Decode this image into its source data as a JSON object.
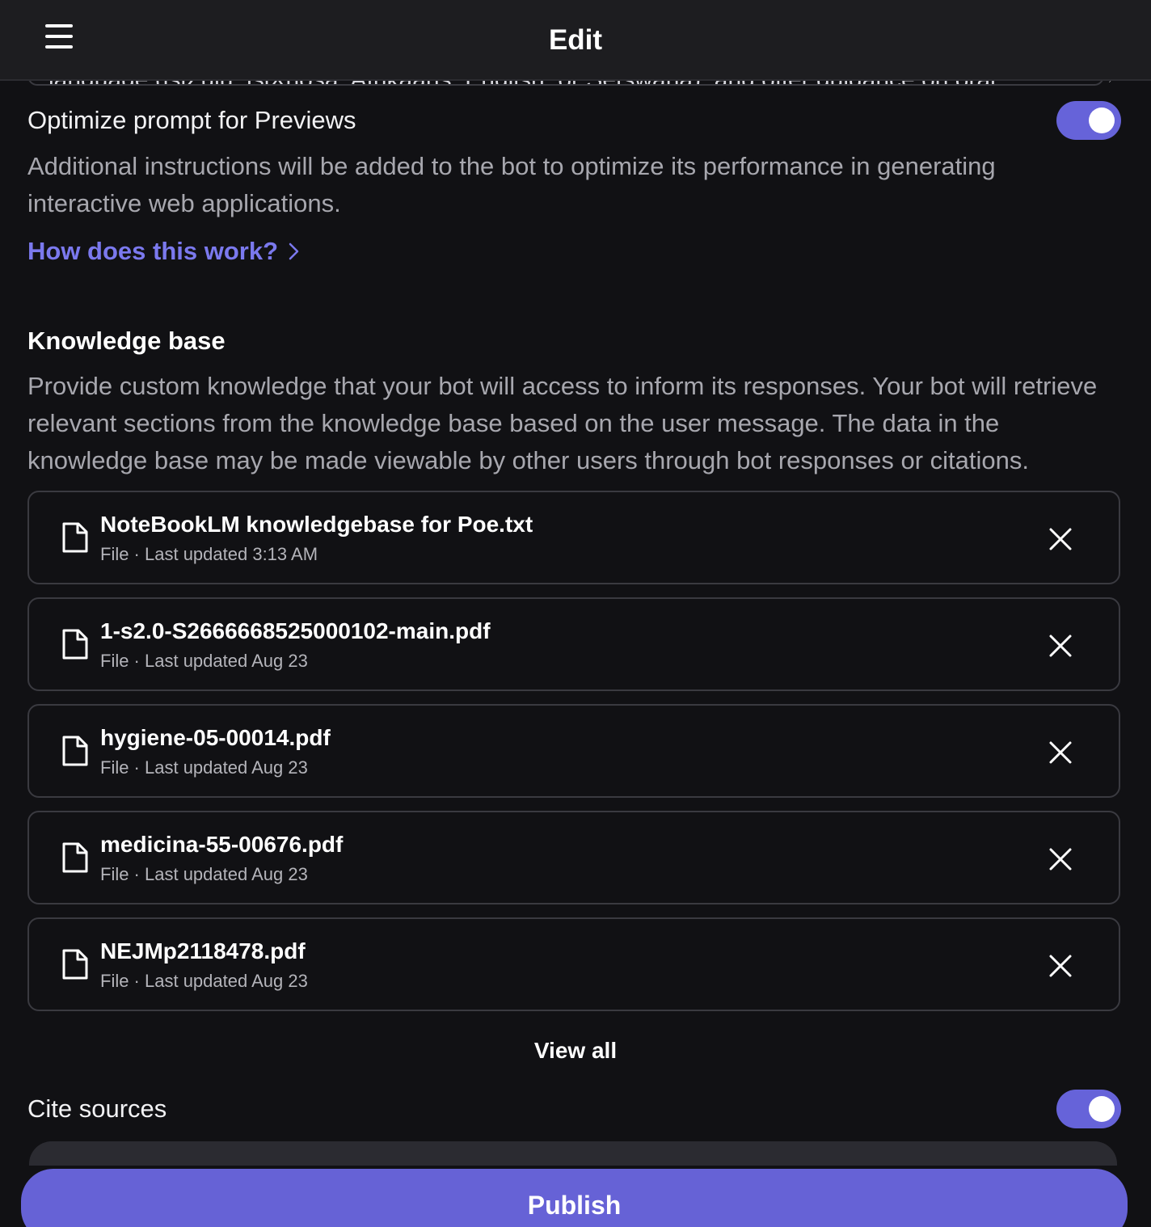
{
  "header": {
    "title": "Edit",
    "menu_icon": "hamburger-menu-icon"
  },
  "previous_field": {
    "clipped_text": "language (isiZulu, isiXhosa, Afrikaans, English, or Setswana), and offer guidance on oral"
  },
  "optimize_previews": {
    "label": "Optimize prompt for Previews",
    "enabled": true,
    "description": "Additional instructions will be added to the bot to optimize its performance in generating interactive web applications.",
    "link_label": "How does this work?"
  },
  "knowledge_base": {
    "title": "Knowledge base",
    "description": "Provide custom knowledge that your bot will access to inform its responses. Your bot will retrieve relevant sections from the knowledge base based on the user message. The data in the knowledge base may be made viewable by other users through bot responses or citations.",
    "files": [
      {
        "name": "NoteBookLM knowledgebase for Poe.txt",
        "meta": "File · Last updated 3:13 AM"
      },
      {
        "name": "1-s2.0-S2666668525000102-main.pdf",
        "meta": "File · Last updated Aug 23"
      },
      {
        "name": "hygiene-05-00014.pdf",
        "meta": "File · Last updated Aug 23"
      },
      {
        "name": "medicina-55-00676.pdf",
        "meta": "File · Last updated Aug 23"
      },
      {
        "name": "NEJMp2118478.pdf",
        "meta": "File · Last updated Aug 23"
      }
    ],
    "view_all_label": "View all"
  },
  "cite_sources": {
    "label": "Cite sources",
    "enabled": true
  },
  "footer": {
    "publish_label": "Publish"
  },
  "colors": {
    "accent": "#6662d6",
    "link": "#7b79ee",
    "background": "#111114",
    "header_bg": "#1d1d20"
  }
}
